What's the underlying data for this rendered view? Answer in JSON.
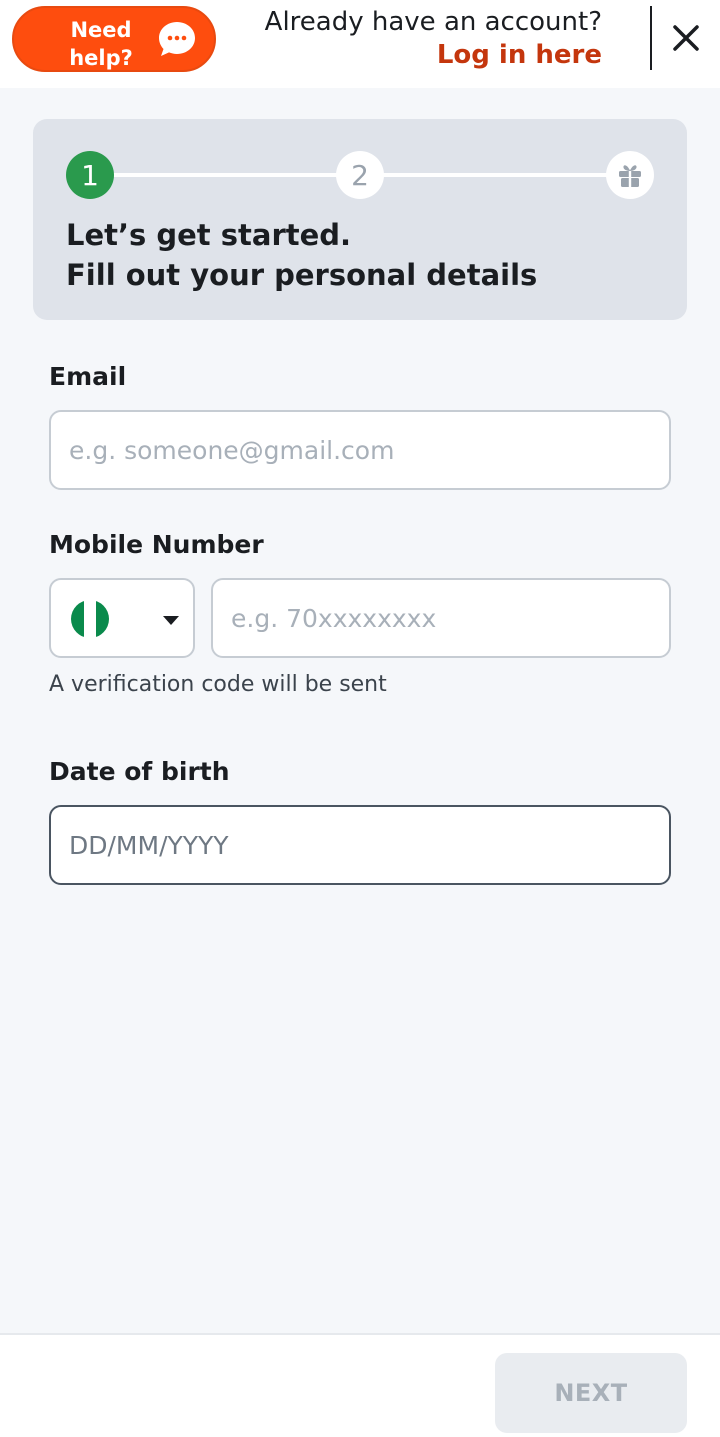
{
  "header": {
    "help_label": "Need\nhelp?",
    "account_prompt": "Already have an account?",
    "login_label": "Log in here"
  },
  "stepper": {
    "steps": [
      {
        "label": "1",
        "state": "active"
      },
      {
        "label": "2",
        "state": "pending"
      },
      {
        "icon": "gift-icon",
        "state": "pending"
      }
    ],
    "title_line1": "Let’s get started.",
    "title_line2": "Fill out your personal details"
  },
  "form": {
    "email": {
      "label": "Email",
      "value": "",
      "placeholder": "e.g. someone@gmail.com"
    },
    "mobile": {
      "label": "Mobile Number",
      "country_flag": "nigeria-flag-icon",
      "value": "",
      "placeholder": "e.g. 70xxxxxxxx",
      "hint": "A verification code will be sent"
    },
    "dob": {
      "label": "Date of birth",
      "value": "",
      "placeholder": "DD/MM/YYYY"
    }
  },
  "footer": {
    "next_label": "NEXT"
  },
  "colors": {
    "brand_orange": "#fe4d0e",
    "login_link": "#c4360d",
    "step_active": "#2a9a4d",
    "card_bg": "#dfe3ea"
  }
}
